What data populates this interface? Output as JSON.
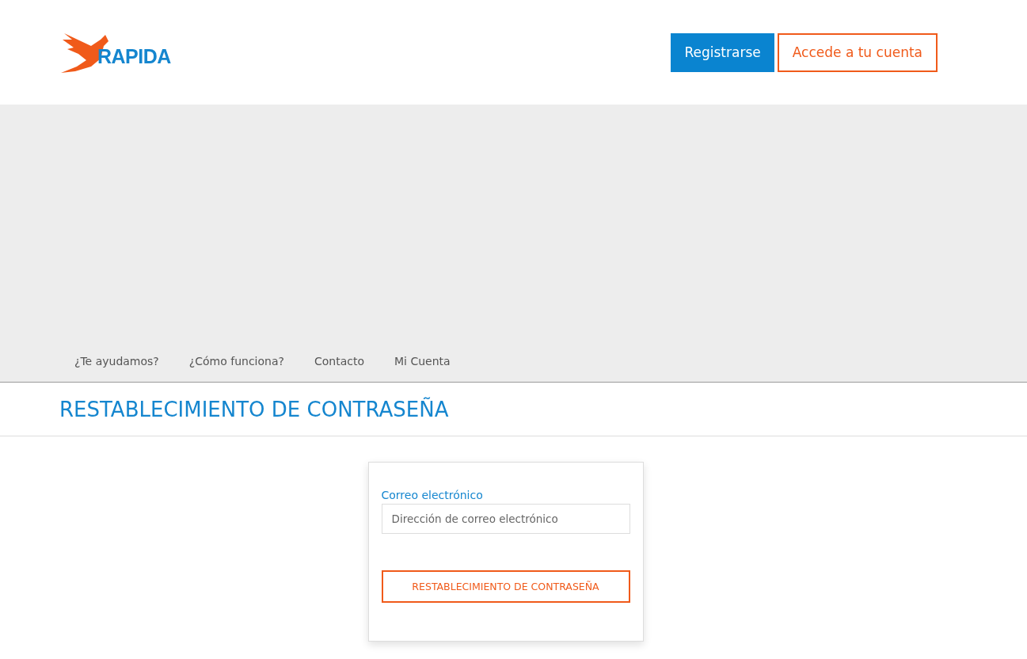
{
  "logo": {
    "text": "RAPIDA"
  },
  "header_buttons": [
    {
      "kind": "filled",
      "label": "Registrarse"
    },
    {
      "kind": "outline",
      "label": "Accede a tu cuenta"
    }
  ],
  "nav": {
    "items": [
      "¿Te ayudamos?",
      "¿Cómo funciona?",
      "Contacto",
      "Mi Cuenta"
    ]
  },
  "page_title": "RESTABLECIMIENTO DE CONTRASEÑA",
  "form": {
    "label": "Correo electrónico",
    "placeholder": "Dirección de correo electrónico",
    "submit": "RESTABLECIMIENTO DE CONTRASEÑA"
  }
}
